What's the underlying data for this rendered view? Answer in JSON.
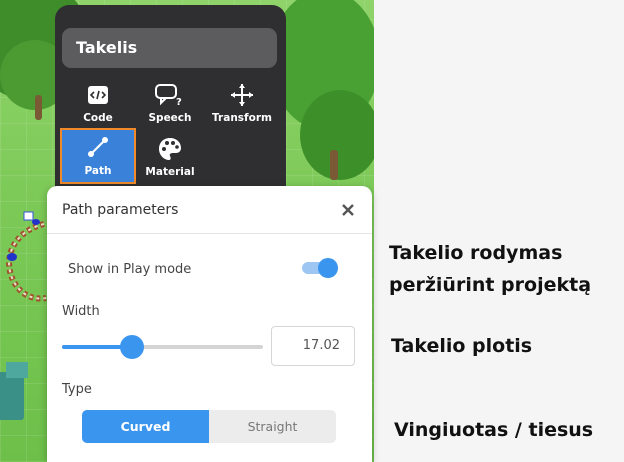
{
  "object_menu": {
    "title": "Takelis",
    "tools": [
      {
        "label": "Code",
        "icon": "code-icon"
      },
      {
        "label": "Speech",
        "icon": "speech-icon"
      },
      {
        "label": "Transform",
        "icon": "move-icon"
      },
      {
        "label": "Path",
        "icon": "path-icon",
        "active": true
      },
      {
        "label": "Material",
        "icon": "palette-icon"
      }
    ]
  },
  "panel": {
    "title": "Path parameters",
    "show_in_play_label": "Show in Play mode",
    "show_in_play_on": true,
    "width_label": "Width",
    "width_value": "17.02",
    "width_fraction": 0.35,
    "type_label": "Type",
    "type_options": [
      "Curved",
      "Straight"
    ],
    "type_selected": "Curved"
  },
  "captions": {
    "show_line1": "Takelio rodymas",
    "show_line2": "peržiūrint projektą",
    "width": "Takelio plotis",
    "type": "Vingiuotas / tiesus"
  },
  "colors": {
    "accent": "#3a95ef",
    "menu_bg": "#2f2f31",
    "active_border": "#f08a2a",
    "grass": "#7cc957"
  }
}
